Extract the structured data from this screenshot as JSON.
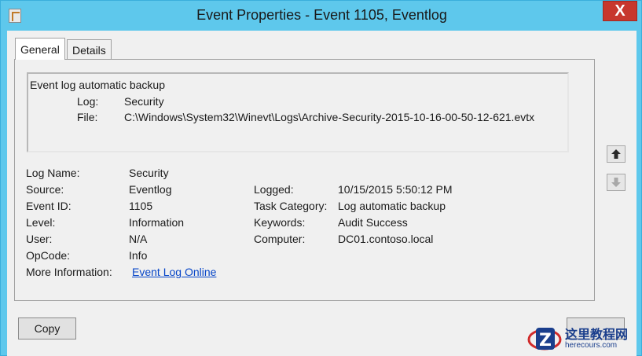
{
  "window": {
    "title": "Event Properties - Event 1105, Eventlog",
    "close_glyph": "X"
  },
  "tabs": [
    {
      "label": "General",
      "selected": true
    },
    {
      "label": "Details",
      "selected": false
    }
  ],
  "description": {
    "heading": "Event log automatic backup",
    "rows": [
      {
        "key": "Log:",
        "value": "Security"
      },
      {
        "key": "File:",
        "value": "C:\\Windows\\System32\\Winevt\\Logs\\Archive-Security-2015-10-16-00-50-12-621.evtx"
      }
    ]
  },
  "properties": {
    "log_name": {
      "label": "Log Name:",
      "value": "Security"
    },
    "source": {
      "label": "Source:",
      "value": "Eventlog"
    },
    "logged": {
      "label": "Logged:",
      "value": "10/15/2015 5:50:12 PM"
    },
    "event_id": {
      "label": "Event ID:",
      "value": "1105"
    },
    "task_category": {
      "label": "Task Category:",
      "value": "Log automatic backup"
    },
    "level": {
      "label": "Level:",
      "value": "Information"
    },
    "keywords": {
      "label": "Keywords:",
      "value": "Audit Success"
    },
    "user": {
      "label": "User:",
      "value": "N/A"
    },
    "computer": {
      "label": "Computer:",
      "value": "DC01.contoso.local"
    },
    "opcode": {
      "label": "OpCode:",
      "value": "Info"
    },
    "more_info": {
      "label": "More Information:",
      "link": "Event Log Online"
    }
  },
  "buttons": {
    "copy": "Copy",
    "up_icon": "arrow-up-icon",
    "down_icon": "arrow-down-icon"
  },
  "watermark": {
    "cn": "这里教程网",
    "url": "herecours.com"
  },
  "colors": {
    "titlebar": "#5ec8ec",
    "close": "#c7372d",
    "link": "#0645c8"
  }
}
